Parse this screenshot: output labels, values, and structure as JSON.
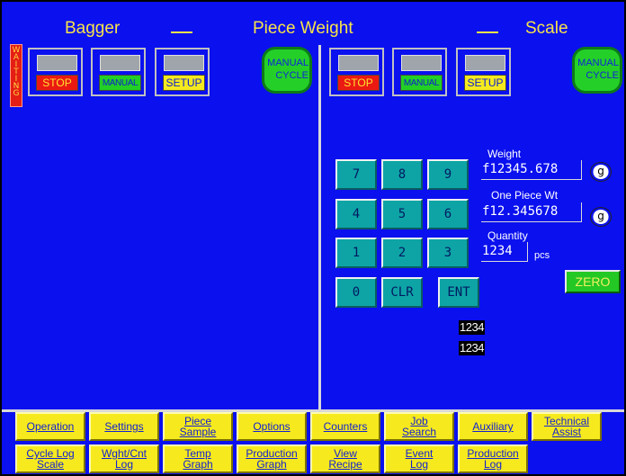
{
  "header": {
    "bagger": "Bagger",
    "piece_weight": "Piece Weight",
    "scale": "Scale"
  },
  "status": {
    "waiting": [
      "W",
      "A",
      "I",
      "T",
      "I",
      "N",
      "G"
    ]
  },
  "bagger_panel": {
    "stop": "STOP",
    "manual": "MANUAL",
    "setup": "SETUP",
    "manual_cycle": "MANUAL\nCYCLE"
  },
  "scale_panel": {
    "stop": "STOP",
    "manual": "MANUAL",
    "setup": "SETUP",
    "manual_cycle": "MANUAL\nCYCLE"
  },
  "keypad": {
    "keys": [
      "7",
      "8",
      "9",
      "4",
      "5",
      "6",
      "1",
      "2",
      "3",
      "0",
      "CLR",
      "ENT"
    ]
  },
  "fields": {
    "weight_label": "Weight",
    "weight_value": "f12345.678",
    "weight_unit": "g",
    "one_piece_label": "One Piece Wt",
    "one_piece_value": "f12.345678",
    "one_piece_unit": "g",
    "quantity_label": "Quantity",
    "quantity_value": "1234",
    "quantity_unit": "pcs"
  },
  "zero_button": "ZERO",
  "readouts": [
    "1234",
    "1234"
  ],
  "tabs_row1": [
    {
      "line1": "Operation",
      "line2": ""
    },
    {
      "line1": "Settings",
      "line2": ""
    },
    {
      "line1": "Piece",
      "line2": "Sample"
    },
    {
      "line1": "Options",
      "line2": ""
    },
    {
      "line1": "Counters",
      "line2": ""
    },
    {
      "line1": "Job",
      "line2": "Search"
    },
    {
      "line1": "Auxiliary",
      "line2": ""
    },
    {
      "line1": "Technical",
      "line2": "Assist"
    }
  ],
  "tabs_row2": [
    {
      "line1": "Cycle Log",
      "line2": "Scale"
    },
    {
      "line1": "Wght/Cnt",
      "line2": "Log"
    },
    {
      "line1": "Temp",
      "line2": "Graph"
    },
    {
      "line1": "Production",
      "line2": "Graph"
    },
    {
      "line1": "View",
      "line2": "Recipe"
    },
    {
      "line1": "Event",
      "line2": "Log"
    },
    {
      "line1": "Production",
      "line2": "Log"
    }
  ],
  "colors": {
    "background": "#0a10ee",
    "title": "#f7e34a",
    "tab": "#f6ea1e",
    "key": "#0ea4a6",
    "green": "#24d028",
    "red": "#ea1a12"
  }
}
